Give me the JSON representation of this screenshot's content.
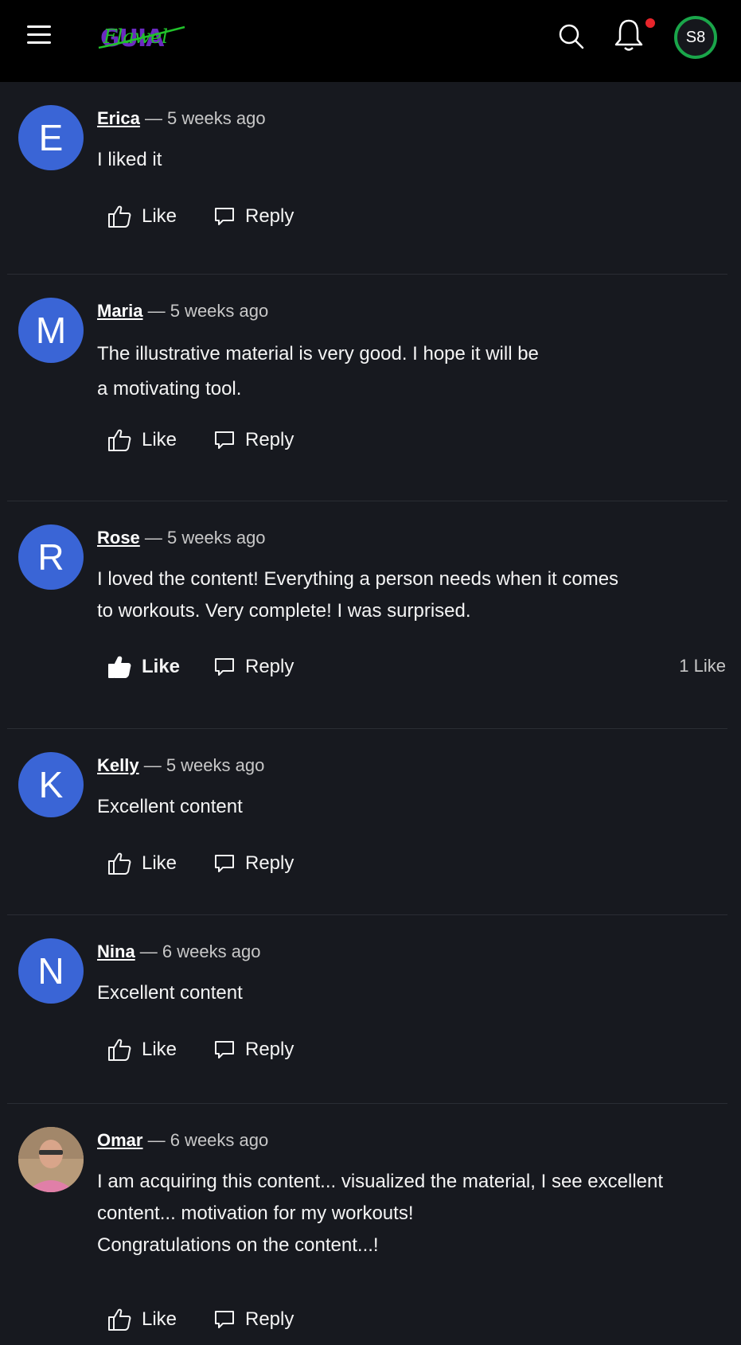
{
  "header": {
    "menu_icon": "hamburger-menu-icon",
    "logo_text": "Flawel",
    "search_icon": "search-icon",
    "bell_icon": "bell-icon",
    "user_initials": "S8",
    "colors": {
      "background": "#000000",
      "notification_dot": "#e8252b",
      "avatar_ring": "#1aa64a",
      "logo_green": "#21c22b",
      "logo_purple": "#6a2ac0"
    }
  },
  "actions": {
    "like_label": "Like",
    "reply_label": "Reply",
    "like_icon": "thumbs-up-icon",
    "reply_icon": "speech-bubble-icon"
  },
  "comments": [
    {
      "initial": "E",
      "author": "Erica",
      "time": "— 5 weeks ago",
      "lines": [
        "I liked it"
      ],
      "liked": false,
      "like_count": ""
    },
    {
      "initial": "M",
      "author": "Maria",
      "time": "— 5 weeks ago",
      "lines": [
        "The illustrative material is very good. I hope it will be",
        "a motivating tool."
      ],
      "liked": false,
      "like_count": ""
    },
    {
      "initial": "R",
      "author": "Rose",
      "time": "— 5 weeks ago",
      "lines": [
        "I loved the content! Everything a person needs when it comes",
        "to workouts. Very complete! I was surprised."
      ],
      "liked": true,
      "like_count": "1 Like"
    },
    {
      "initial": "K",
      "author": "Kelly",
      "time": "— 5 weeks ago",
      "lines": [
        "Excellent content"
      ],
      "liked": false,
      "like_count": ""
    },
    {
      "initial": "N",
      "author": "Nina",
      "time": "— 6 weeks ago",
      "lines": [
        "Excellent content"
      ],
      "liked": false,
      "like_count": ""
    },
    {
      "initial": "",
      "author": "Omar",
      "time": "— 6 weeks ago",
      "lines": [
        "I am acquiring this content... visualized the material, I see excellent",
        "content... motivation for my workouts!",
        "Congratulations on the content...!"
      ],
      "liked": false,
      "like_count": "",
      "avatar_photo": true
    }
  ],
  "colors": {
    "page_bg": "#17191f",
    "avatar_blue": "#3a65d6",
    "divider": "#2a2d34"
  }
}
